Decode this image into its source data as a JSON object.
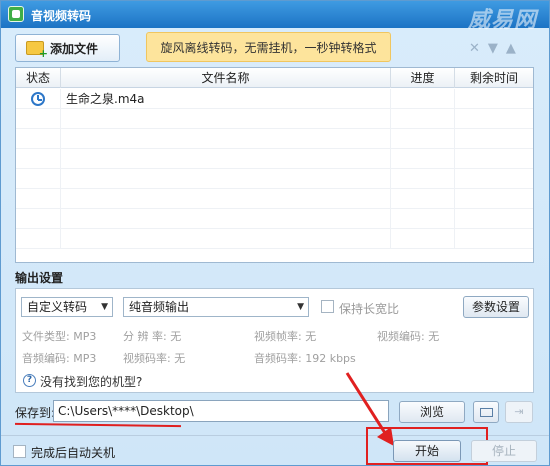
{
  "window": {
    "title": "音视频转码",
    "watermark": "威易网"
  },
  "toolbar": {
    "add_file_label": "添加文件",
    "banner_text": "旋风离线转码，无需挂机，一秒钟转格式",
    "icons": [
      "close-icon",
      "arrow-down-icon",
      "arrow-up-icon"
    ]
  },
  "table": {
    "headers": [
      "状态",
      "文件名称",
      "进度",
      "剩余时间"
    ],
    "rows": [
      {
        "status_icon": "clock-icon",
        "name": "生命之泉.m4a",
        "progress": "",
        "remaining": ""
      }
    ]
  },
  "output": {
    "section_title": "输出设置",
    "profile_select": "自定义转码",
    "mode_select": "纯音频输出",
    "keep_ratio_label": "保持长宽比",
    "param_button": "参数设置",
    "specs": {
      "file_type": "文件类型:  MP3",
      "resolution": "分 辨 率:  无",
      "video_fps": "视频帧率:  无",
      "video_codec": "视频编码:  无",
      "audio_codec": "音频编码:  MP3",
      "video_bitrate": "视频码率:  无",
      "audio_bitrate": "音频码率:  192 kbps"
    },
    "help_link": "没有找到您的机型?"
  },
  "save": {
    "label": "保存到:",
    "path": "C:\\Users\\****\\Desktop\\",
    "browse_button": "浏览"
  },
  "bottom": {
    "auto_shutdown_label": "完成后自动关机",
    "start_button": "开始",
    "stop_button": "停止"
  },
  "colors": {
    "titlebar": "#1c73c4",
    "banner": "#fde49c",
    "annotation_red": "#e02020"
  }
}
